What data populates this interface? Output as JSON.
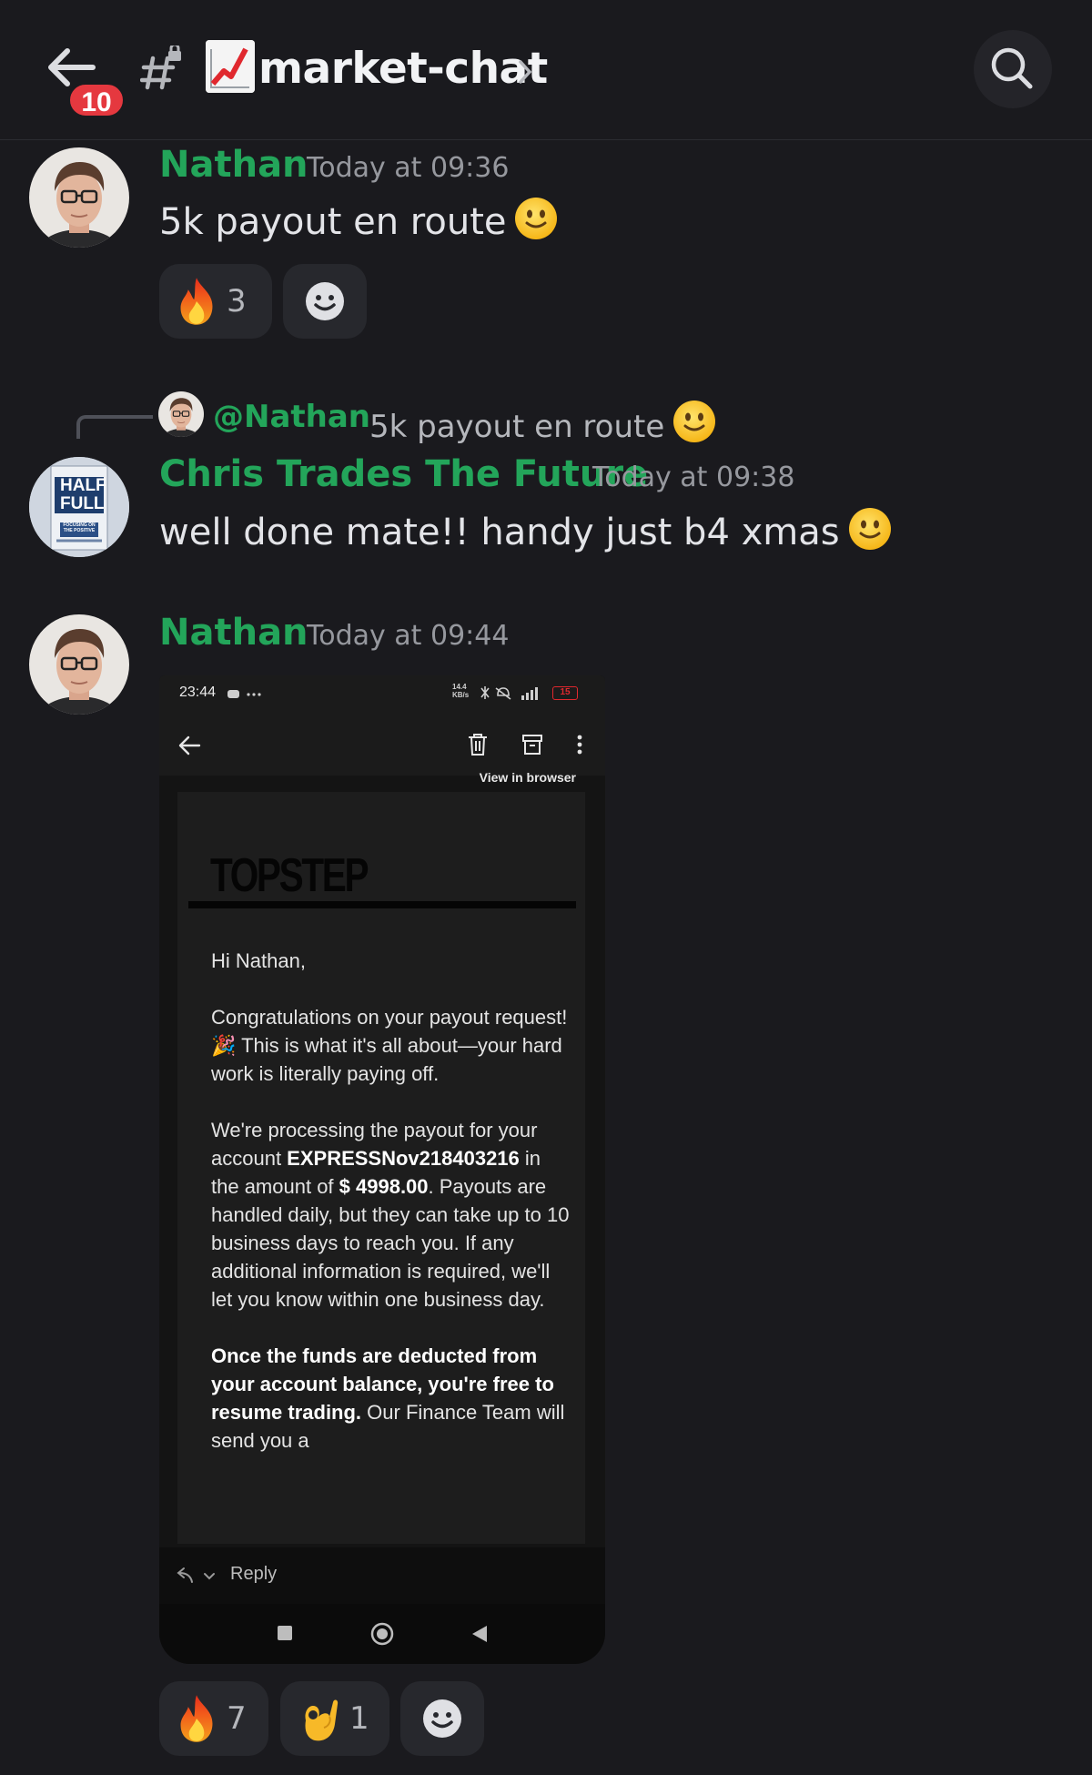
{
  "header": {
    "unread_badge": "10",
    "channel_name": "market-chat",
    "icons": [
      "back-arrow-icon",
      "threads-icon",
      "chart-increasing-icon",
      "chevron-right-icon",
      "search-icon"
    ]
  },
  "messages": [
    {
      "author": "Nathan",
      "time": "Today at 09:36",
      "text": "5k payout en route",
      "reactions": [
        {
          "emoji": "fire",
          "count": "3"
        }
      ]
    },
    {
      "reply_to": {
        "mention": "@Nathan",
        "text": "5k payout en route"
      },
      "author": "Chris Trades The Future",
      "time": "Today at 09:38",
      "text": "well done mate!! handy just b4 xmas",
      "avatar_text": [
        "HALF",
        "FULL",
        "FOCUSING ON THE POSITIVE"
      ]
    },
    {
      "author": "Nathan",
      "time": "Today at 09:44",
      "reactions": [
        {
          "emoji": "fire",
          "count": "7"
        },
        {
          "emoji": "ok-hand",
          "count": "1"
        }
      ]
    }
  ],
  "screenshot": {
    "status_time": "23:44",
    "status_speed": "14.4 KB/s",
    "battery": "15",
    "view_in_browser": "View in browser",
    "logo": "TOPSTEP",
    "greeting": "Hi Nathan,",
    "p1": "Congratulations on your payout request! 🎉 This is what it's all about—your hard work is literally paying off.",
    "p2_a": "We're processing the payout for your account ",
    "p2_account": "EXPRESSNov218403216",
    "p2_b": " in the amount of ",
    "p2_amount": "$ 4998.00",
    "p2_c": ". Payouts are handled daily, but they can take up to 10 business days to reach you. If any additional information is required, we'll let you know within one business day.",
    "p3_bold": "Once the funds are deducted from your account balance, you're free to resume trading.",
    "p3_rest": " Our Finance Team will send you a",
    "reply_label": "Reply"
  },
  "colors": {
    "background": "#1a1a1e",
    "author_green": "#23a55a",
    "badge_red": "#e5383f",
    "reaction_bg": "#27282d"
  }
}
